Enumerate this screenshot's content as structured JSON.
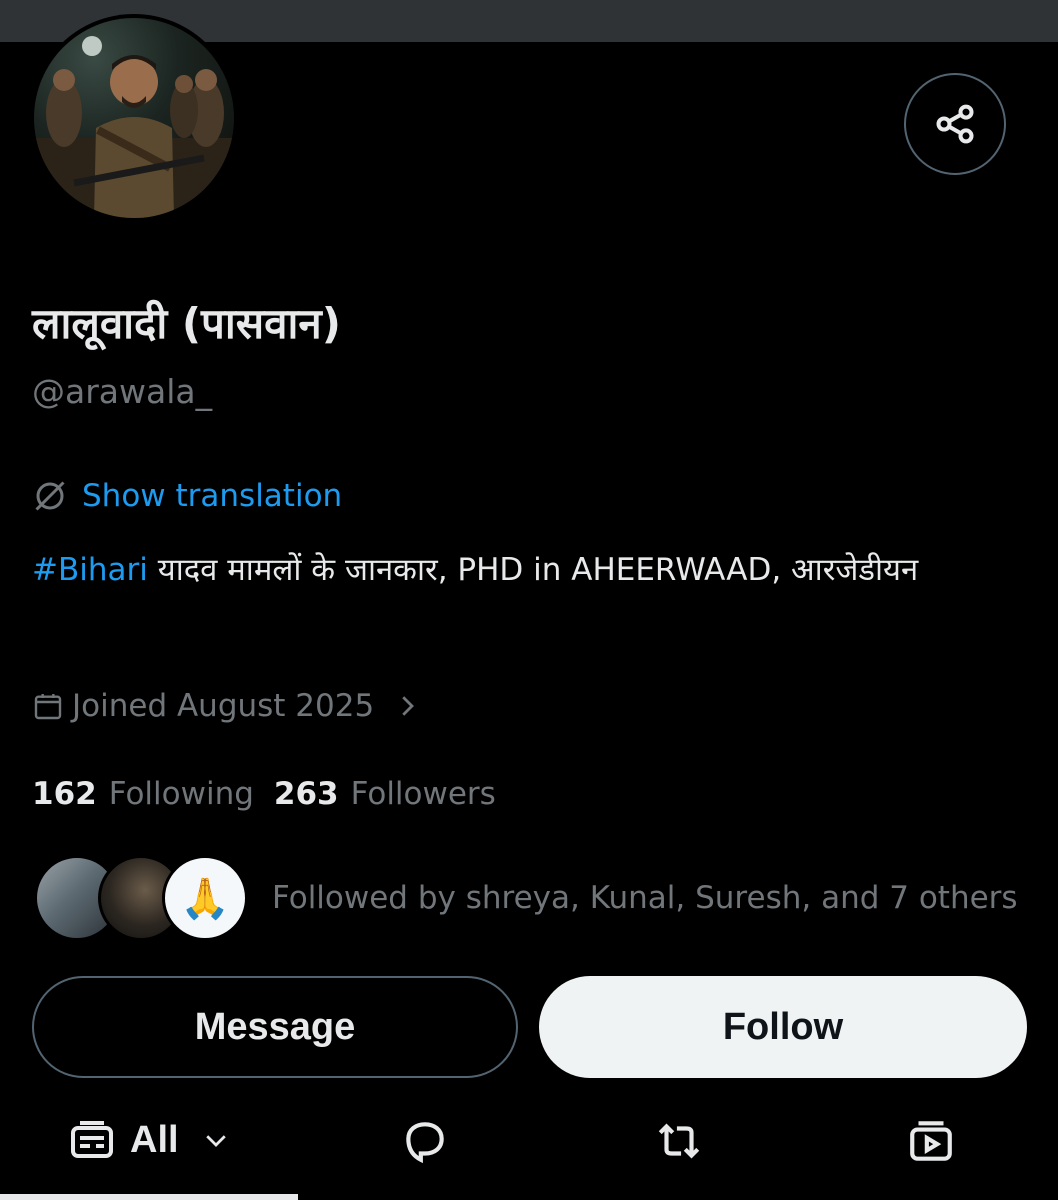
{
  "profile": {
    "display_name": "लालूवादी (पासवान)",
    "handle": "@arawala_",
    "show_translation": "Show translation",
    "bio_hashtag": "#Bihari",
    "bio_text": " यादव मामलों के जानकार, PHD in AHEERWAAD, आरजेडीयन",
    "joined": "Joined August 2025"
  },
  "stats": {
    "following_count": "162",
    "following_label": "Following",
    "followers_count": "263",
    "followers_label": "Followers"
  },
  "followed_by": {
    "text": "Followed by shreya, Kunal, Suresh, and 7 others",
    "avatar3_glyph": "🙏"
  },
  "actions": {
    "message_label": "Message",
    "follow_label": "Follow"
  },
  "tabs": {
    "all_label": "All"
  },
  "icons": {
    "share": "share-icon",
    "translate": "translate-icon",
    "calendar": "calendar-icon",
    "chevron": "chevron-right-icon",
    "feed": "feed-icon",
    "reply": "reply-icon",
    "repost": "repost-icon",
    "media": "media-icon"
  },
  "colors": {
    "background": "#000000",
    "accent_blue": "#1d9bf0",
    "text_primary": "#e7e9ea",
    "text_secondary": "#71767b",
    "follow_button_bg": "#eff3f4"
  }
}
